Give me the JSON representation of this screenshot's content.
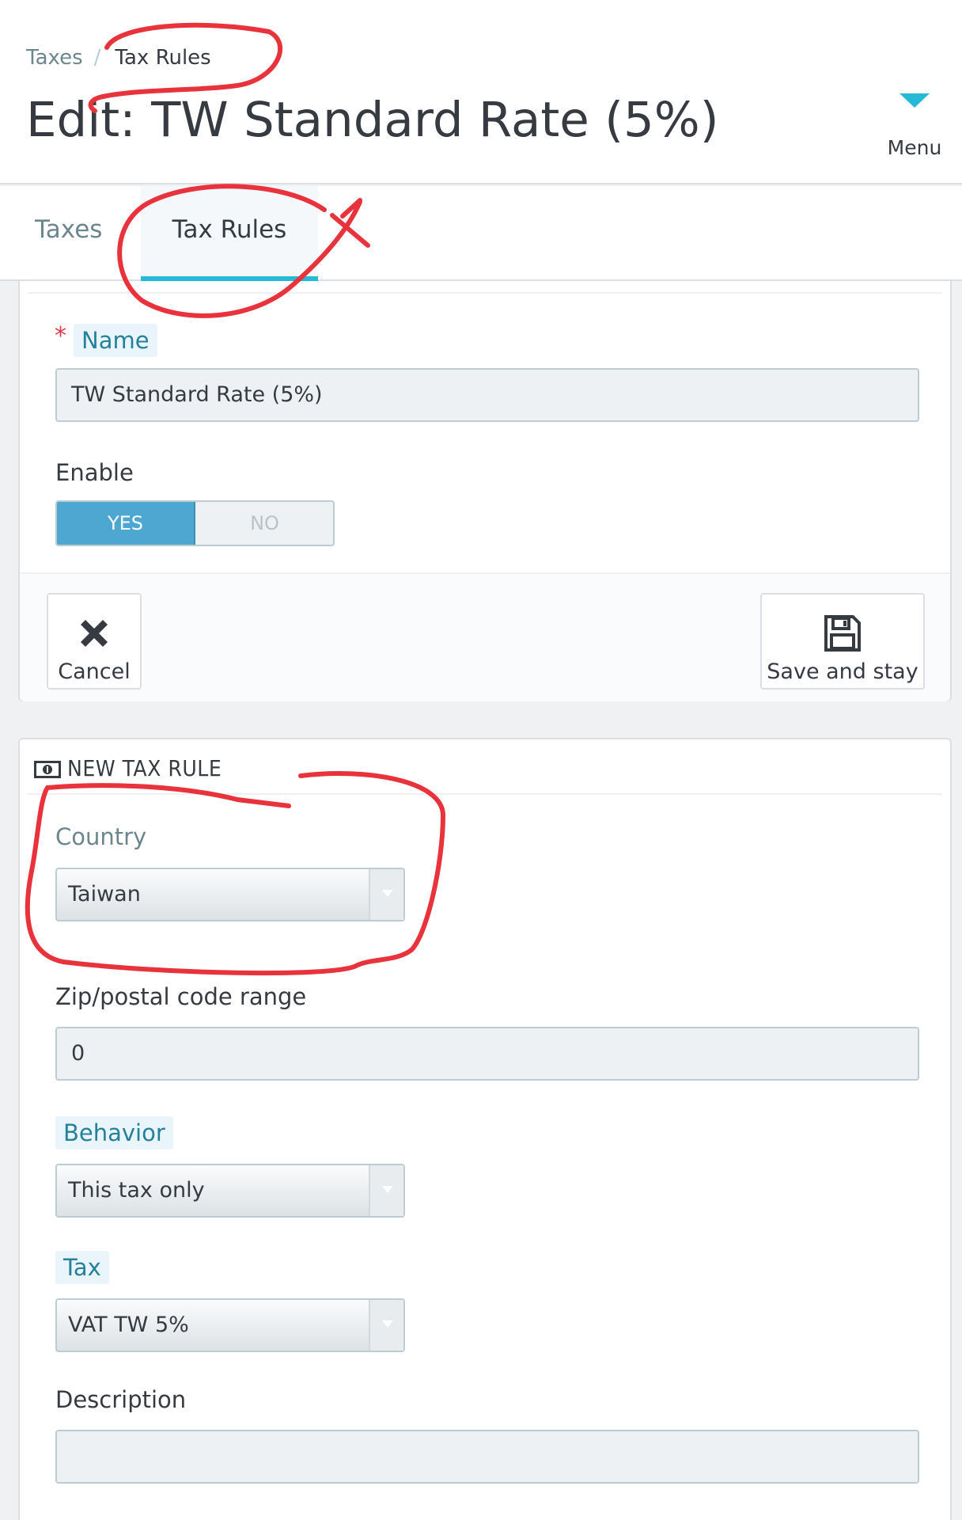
{
  "breadcrumb": {
    "parent": "Taxes",
    "current": "Tax Rules"
  },
  "page_title": "Edit: TW Standard Rate (5%)",
  "menu": {
    "label": "Menu"
  },
  "tabs": [
    {
      "label": "Taxes"
    },
    {
      "label": "Tax Rules"
    }
  ],
  "form": {
    "name_label": "Name",
    "name_value": "TW Standard Rate (5%)",
    "enable_label": "Enable",
    "enable_yes": "YES",
    "enable_no": "NO",
    "enable_value": "YES",
    "cancel_label": "Cancel",
    "save_label": "Save and stay"
  },
  "new_tax_rule": {
    "heading": "NEW TAX RULE",
    "country_label": "Country",
    "country_value": "Taiwan",
    "zip_label": "Zip/postal code range",
    "zip_value": "0",
    "behavior_label": "Behavior",
    "behavior_value": "This tax only",
    "tax_label": "Tax",
    "tax_value": "VAT TW 5%",
    "description_label": "Description",
    "description_value": ""
  },
  "colors": {
    "accent": "#25b9d7",
    "switch_on": "#4da7d0",
    "annotation": "#e8323c",
    "required": "#e0384b"
  }
}
